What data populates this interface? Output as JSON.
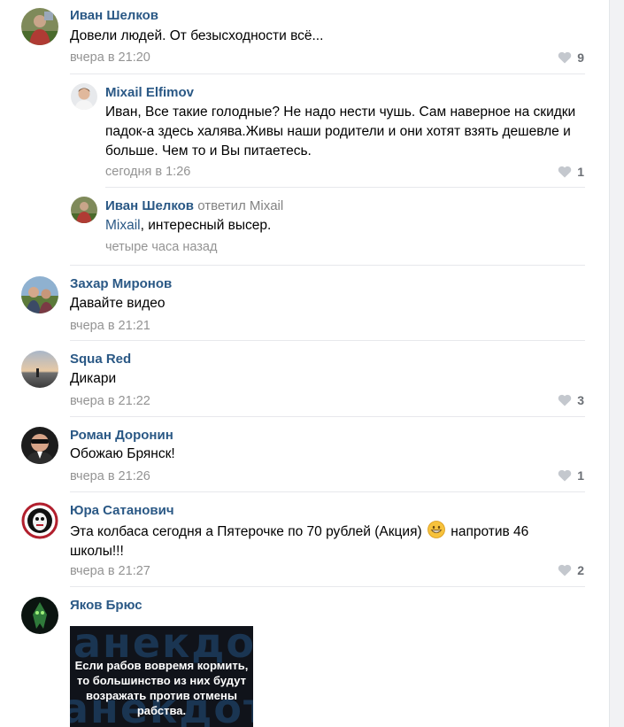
{
  "comments": [
    {
      "author": "Иван Шелков",
      "text": "Довели людей. От безысходности всё...",
      "time": "вчера в 21:20",
      "likes": "9"
    },
    {
      "author": "Mixail Elfimov",
      "text": "Иван, Все такие голодные? Не надо нести чушь. Сам наверное на скидки падок-а здесь халява.Живы наши родители и они хотят взять дешевле и больше. Чем то и Вы питаетесь.",
      "time": "сегодня в 1:26",
      "likes": "1"
    },
    {
      "author": "Иван Шелков",
      "replied_label": "ответил Mixail",
      "mention": "Mixail",
      "text": ", интересный высер.",
      "time": "четыре часа назад"
    },
    {
      "author": "Захар Миронов",
      "text": "Давайте видео",
      "time": "вчера в 21:21"
    },
    {
      "author": "Squa Red",
      "text": "Дикари",
      "time": "вчера в 21:22",
      "likes": "3"
    },
    {
      "author": "Роман Доронин",
      "text": "Обожаю Брянск!",
      "time": "вчера в 21:26",
      "likes": "1"
    },
    {
      "author": "Юра Сатанович",
      "text_before": "Эта колбаса сегодня а Пятерочке по 70 рублей (Акция)",
      "text_after": "напротив 46 школы!!!",
      "time": "вчера в 21:27",
      "likes": "2"
    },
    {
      "author": "Яков Брюс",
      "image": {
        "watermark": "анекдоты.n",
        "caption": "Если рабов вовремя кормить, то большинство из них будут возражать против отмены рабства."
      }
    }
  ],
  "icons": {
    "like": "heart-icon",
    "emoji": "grinning-face-emoji"
  },
  "colors": {
    "author": "#2a5885",
    "meta": "#939393",
    "likes": "#6b6f75",
    "divider": "#e7e8ec"
  }
}
